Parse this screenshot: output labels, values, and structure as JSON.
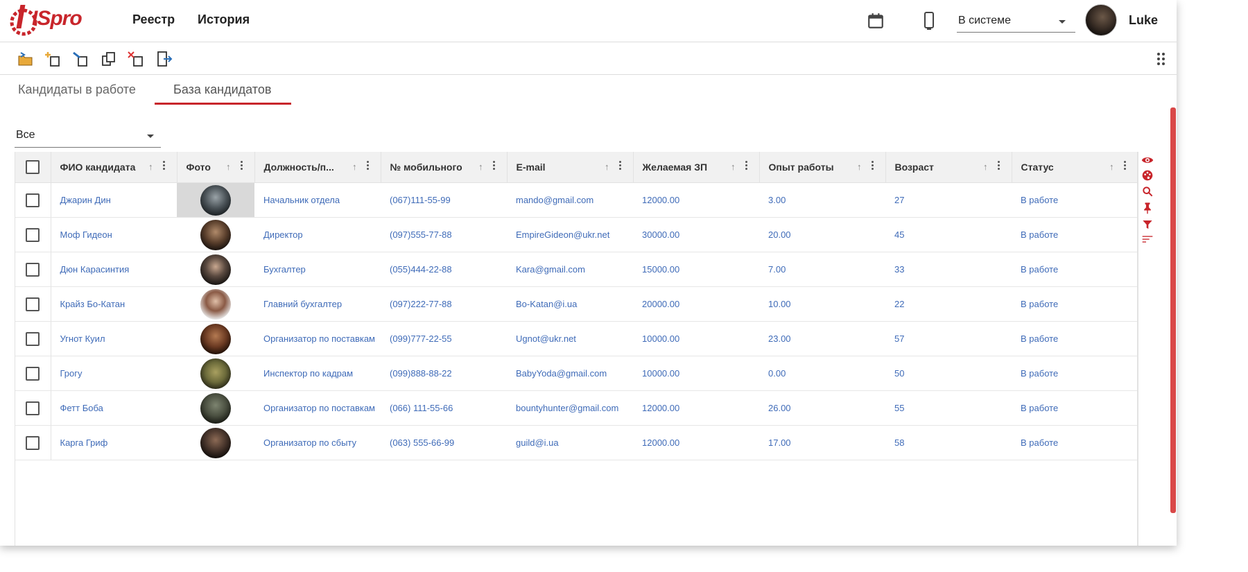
{
  "header": {
    "logo_text": "ISpro",
    "nav": [
      "Реестр",
      "История"
    ],
    "status_select": "В системе",
    "user_name": "Luke",
    "icons": [
      "calendar-icon",
      "phone-icon",
      "chevron-down-icon"
    ]
  },
  "toolbar": {
    "icons": [
      "open-folder-icon",
      "add-record-icon",
      "edit-record-icon",
      "copy-icon",
      "delete-icon",
      "exit-icon",
      "grid-menu-icon"
    ]
  },
  "tabs": {
    "tab1": "Кандидаты в работе",
    "tab2": "База кандидатов",
    "active": "База кандидатов"
  },
  "filter": {
    "value": "Все"
  },
  "table": {
    "columns": {
      "name": "ФИО кандидата",
      "photo": "Фото",
      "position": "Должность/п...",
      "phone": "№ мобильного",
      "email": "E-mail",
      "salary": "Желаемая ЗП",
      "experience": "Опыт работы",
      "age": "Возраст",
      "status": "Статус"
    },
    "rows": [
      {
        "name": "Джарин Дин",
        "position": "Начальник отдела",
        "phone": "(067)111-55-99",
        "email": "mando@gmail.com",
        "salary": "12000.00",
        "experience": "3.00",
        "age": "27",
        "status": "В работе"
      },
      {
        "name": "Моф Гидеон",
        "position": "Директор",
        "phone": "(097)555-77-88",
        "email": "EmpireGideon@ukr.net",
        "salary": "30000.00",
        "experience": "20.00",
        "age": "45",
        "status": "В работе"
      },
      {
        "name": "Дюн Карасинтия",
        "position": "Бухгалтер",
        "phone": "(055)444-22-88",
        "email": "Kara@gmail.com",
        "salary": "15000.00",
        "experience": "7.00",
        "age": "33",
        "status": "В работе"
      },
      {
        "name": "Крайз Бо-Катан",
        "position": "Главний бухгалтер",
        "phone": "(097)222-77-88",
        "email": "Bo-Katan@i.ua",
        "salary": "20000.00",
        "experience": "10.00",
        "age": "22",
        "status": "В работе"
      },
      {
        "name": "Угнот Куил",
        "position": "Организатор по поставкам",
        "phone": "(099)777-22-55",
        "email": "Ugnot@ukr.net",
        "salary": "10000.00",
        "experience": "23.00",
        "age": "57",
        "status": "В работе"
      },
      {
        "name": "Грогу",
        "position": "Инспектор по кадрам",
        "phone": "(099)888-88-22",
        "email": "BabyYoda@gmail.com",
        "salary": "10000.00",
        "experience": "0.00",
        "age": "50",
        "status": "В работе"
      },
      {
        "name": "Фетт Боба",
        "position": "Организатор по поставкам",
        "phone": "(066) 111-55-66",
        "email": "bountyhunter@gmail.com",
        "salary": "12000.00",
        "experience": "26.00",
        "age": "55",
        "status": "В работе"
      },
      {
        "name": "Карга Гриф",
        "position": "Организатор по сбыту",
        "phone": "(063) 555-66-99",
        "email": "guild@i.ua",
        "salary": "12000.00",
        "experience": "17.00",
        "age": "58",
        "status": "В работе"
      }
    ]
  },
  "side_tools": [
    "eye-icon",
    "palette-icon",
    "search-icon",
    "pin-icon",
    "filter-icon",
    "sort-lines-icon"
  ],
  "colors": {
    "accent": "#c8252b",
    "link": "#3f6bb8",
    "scrollbar": "#d94848"
  }
}
